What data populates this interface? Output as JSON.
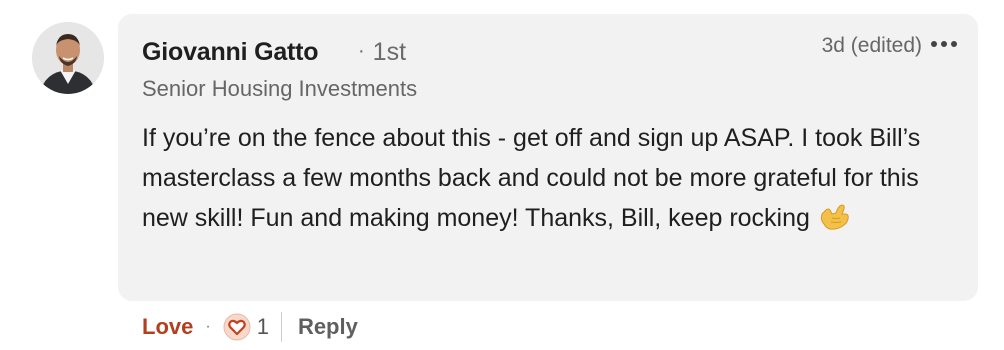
{
  "comment": {
    "author": {
      "name": "Giovanni Gatto",
      "connection_degree": "1st",
      "headline": "Senior Housing Investments",
      "avatar_icon": "profile-photo"
    },
    "meta": {
      "timestamp": "3d",
      "edited_label": "(edited)",
      "more_icon": "ellipsis-icon"
    },
    "text": "If you’re on the fence about this - get off and sign up ASAP. I took Bill’s masterclass a few months back and could not be more grateful for this new skill! Fun and making money! Thanks, Bill, keep rocking",
    "emoji_icon": "call-me-hand-emoji"
  },
  "actions": {
    "love_label": "Love",
    "separator": "·",
    "reaction_icon": "heart-reaction-icon",
    "reaction_count": "1",
    "reply_label": "Reply"
  },
  "colors": {
    "bubble_bg": "#f2f2f2",
    "love_active": "#b24020",
    "text_primary": "#1f1f1f",
    "text_secondary": "#666666"
  }
}
